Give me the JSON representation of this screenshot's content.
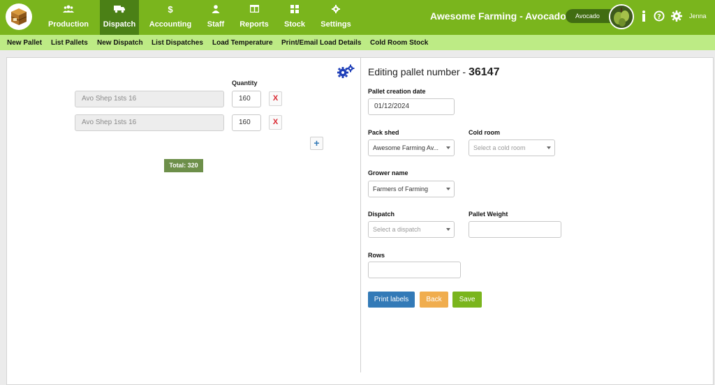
{
  "nav": {
    "items": [
      {
        "label": "Production",
        "icon": "users-icon"
      },
      {
        "label": "Dispatch",
        "icon": "truck-icon",
        "active": true
      },
      {
        "label": "Accounting",
        "icon": "dollar-icon"
      },
      {
        "label": "Staff",
        "icon": "person-icon"
      },
      {
        "label": "Reports",
        "icon": "report-icon"
      },
      {
        "label": "Stock",
        "icon": "grid-icon"
      },
      {
        "label": "Settings",
        "icon": "gear-icon"
      }
    ],
    "brand": "Awesome Farming - Avocados",
    "product": "Avocado",
    "user": "Jenna"
  },
  "subnav": {
    "items": [
      "New Pallet",
      "List Pallets",
      "New Dispatch",
      "List Dispatches",
      "Load Temperature",
      "Print/Email Load Details",
      "Cold Room Stock"
    ]
  },
  "pallet_items": {
    "quantity_header": "Quantity",
    "rows": [
      {
        "product": "Avo Shep 1sts 16",
        "quantity": "160",
        "remove": "X"
      },
      {
        "product": "Avo Shep 1sts 16",
        "quantity": "160",
        "remove": "X"
      }
    ],
    "add": "+",
    "total": "Total: 320"
  },
  "form": {
    "title_prefix": "Editing pallet number - ",
    "pallet_number": "36147",
    "creation_date_label": "Pallet creation date",
    "creation_date": "01/12/2024",
    "pack_shed_label": "Pack shed",
    "pack_shed": "Awesome Farming Av...",
    "cold_room_label": "Cold room",
    "cold_room_placeholder": "Select a cold room",
    "grower_label": "Grower name",
    "grower": "Farmers of Farming",
    "dispatch_label": "Dispatch",
    "dispatch_placeholder": "Select a dispatch",
    "weight_label": "Pallet Weight",
    "weight": "",
    "rows_label": "Rows",
    "rows": ""
  },
  "buttons": {
    "print": "Print labels",
    "back": "Back",
    "save": "Save"
  },
  "colors": {
    "topbar": "#7ab51d",
    "active_nav": "#4b8016",
    "subbar": "#bdeb85",
    "print": "#337ab7",
    "back": "#f0ad4e",
    "save": "#7ab51d",
    "remove": "#d9262f"
  }
}
